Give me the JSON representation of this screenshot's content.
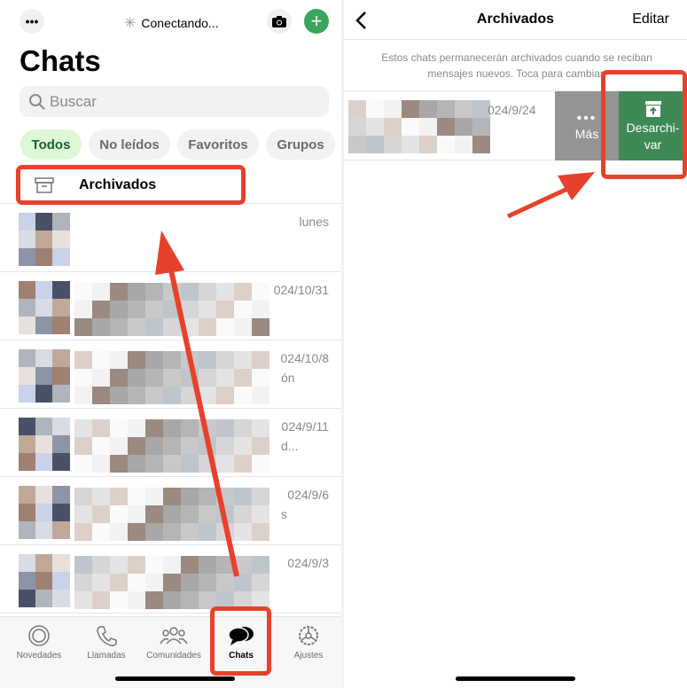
{
  "left": {
    "status": "Conectando...",
    "title": "Chats",
    "search_placeholder": "Buscar",
    "filters": [
      "Todos",
      "No leídos",
      "Favoritos",
      "Grupos"
    ],
    "archived_label": "Archivados",
    "chats": [
      {
        "date": "lunes",
        "preview": ""
      },
      {
        "date": "024/10/31",
        "preview": ""
      },
      {
        "date": "024/10/8",
        "preview": "ón"
      },
      {
        "date": "024/9/11",
        "preview": "d..."
      },
      {
        "date": "024/9/6",
        "preview": "s"
      },
      {
        "date": "024/9/3",
        "preview": ""
      }
    ],
    "tabs": [
      "Novedades",
      "Llamadas",
      "Comunidades",
      "Chats",
      "Ajustes"
    ],
    "active_tab": "Chats"
  },
  "right": {
    "title": "Archivados",
    "edit": "Editar",
    "notice": "Estos chats permanecerán archivados cuando se reciban mensajes nuevos. Toca para cambiar.",
    "chat_date": "024/9/24",
    "more_label": "Más",
    "unarchive_label": "Desarchi-var"
  },
  "colors": {
    "accent": "#3f8957",
    "highlight": "#e8412b",
    "chip_active": "#dcf8d4",
    "plus": "#3aa55c"
  }
}
